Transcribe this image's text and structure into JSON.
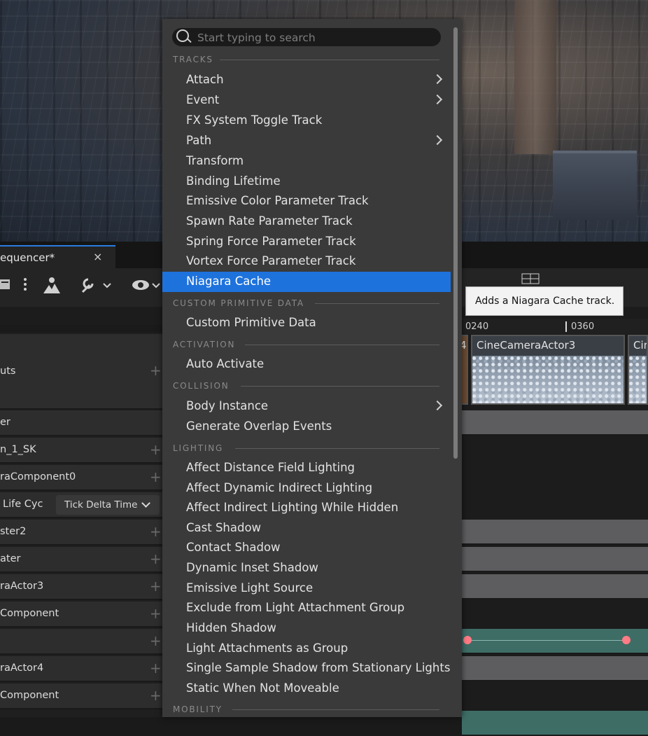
{
  "sequencer": {
    "tab_title": "equencer*",
    "tab_close": "×",
    "ruler": [
      "0240",
      "0360"
    ],
    "shots": [
      "CineCameraActor3",
      "Cir"
    ],
    "shot_partial": "4"
  },
  "outliner_rows": [
    {
      "label": "uts"
    },
    {
      "label": "er"
    },
    {
      "label": "n_1_SK"
    },
    {
      "label": "raComponent0"
    },
    {
      "label": "Life Cyc"
    },
    {
      "label": "ster2"
    },
    {
      "label": "ater"
    },
    {
      "label": "raActor3"
    },
    {
      "label": "Component"
    },
    {
      "label": ""
    },
    {
      "label": "raActor4"
    },
    {
      "label": "Component"
    }
  ],
  "tick_button": "Tick Delta Time",
  "tooltip": "Adds a Niagara Cache track.",
  "menu": {
    "search_placeholder": "Start typing to search",
    "sections": {
      "tracks": "TRACKS",
      "custom_primitive_data": "CUSTOM PRIMITIVE DATA",
      "activation": "ACTIVATION",
      "collision": "COLLISION",
      "lighting": "LIGHTING",
      "mobility": "MOBILITY"
    },
    "tracks_items": [
      "Attach",
      "Event",
      "FX System Toggle Track",
      "Path",
      "Transform",
      "Binding Lifetime",
      "Emissive Color Parameter Track",
      "Spawn Rate Parameter Track",
      "Spring Force Parameter Track",
      "Vortex Force Parameter Track",
      "Niagara Cache"
    ],
    "custom_items": [
      "Custom Primitive Data"
    ],
    "activation_items": [
      "Auto Activate"
    ],
    "collision_items": [
      "Body Instance",
      "Generate Overlap Events"
    ],
    "lighting_items": [
      "Affect Distance Field Lighting",
      "Affect Dynamic Indirect Lighting",
      "Affect Indirect Lighting While Hidden",
      "Cast Shadow",
      "Contact Shadow",
      "Dynamic Inset Shadow",
      "Emissive Light Source",
      "Exclude from Light Attachment Group",
      "Hidden Shadow",
      "Light Attachments as Group",
      "Single Sample Shadow from Stationary Lights",
      "Static When Not Moveable"
    ]
  },
  "colors": {
    "highlight": "#1e72dc",
    "menu_bg": "#3a3a3a"
  }
}
